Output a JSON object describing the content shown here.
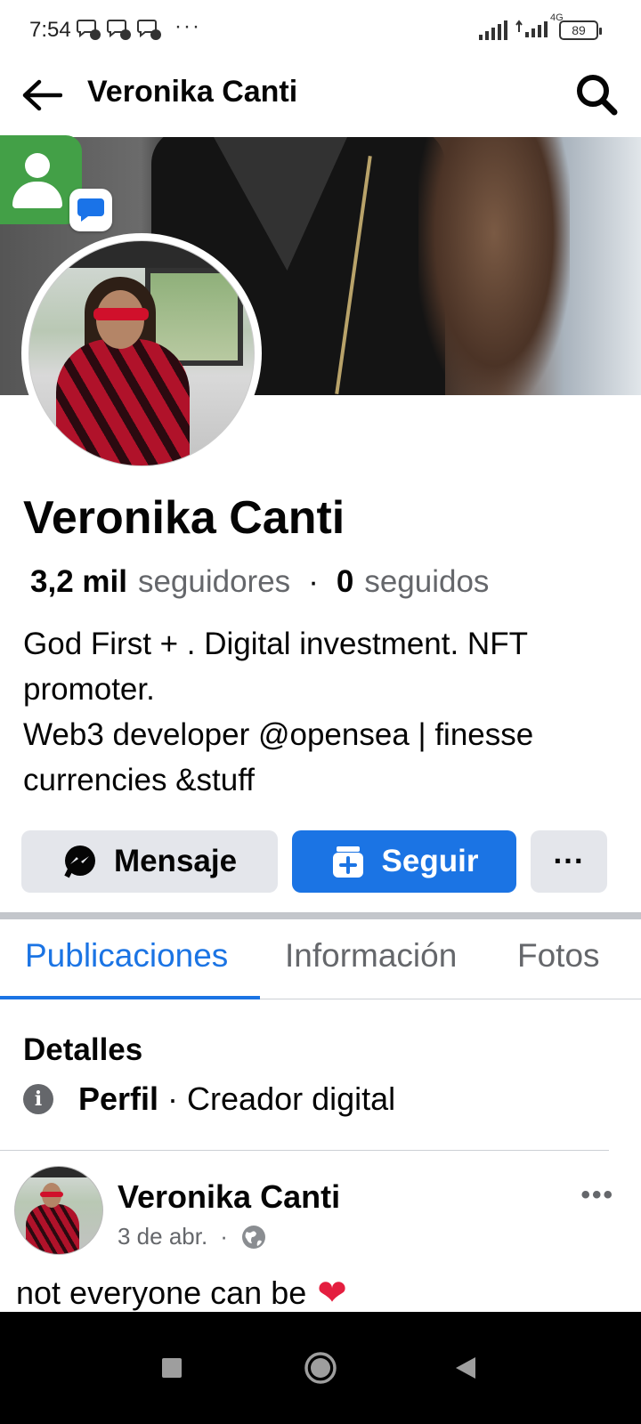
{
  "status_bar": {
    "time": "7:54",
    "more": "···",
    "network": "4G",
    "battery": "89"
  },
  "header": {
    "title": "Veronika Canti"
  },
  "profile": {
    "name": "Veronika Canti",
    "followers_count": "3,2 mil",
    "followers_label": "seguidores",
    "separator": "·",
    "following_count": "0",
    "following_label": "seguidos",
    "bio_lines": [
      "God First + . Digital investment. NFT",
      "promoter.",
      "Web3 developer @opensea | finesse",
      "currencies &stuff"
    ]
  },
  "actions": {
    "message_label": "Mensaje",
    "follow_label": "Seguir",
    "more_label": "···"
  },
  "tabs": [
    {
      "label": "Publicaciones",
      "active": true
    },
    {
      "label": "Información",
      "active": false
    },
    {
      "label": "Fotos",
      "active": false
    }
  ],
  "details": {
    "title": "Detalles",
    "info_icon": "i",
    "profile_label": "Perfil",
    "profile_value": "· Creador digital"
  },
  "post": {
    "author": "Veronika Canti",
    "date": "3 de abr.",
    "dot": "·",
    "more": "•••",
    "text": "not everyone can be",
    "emoji": "❤"
  },
  "colors": {
    "accent": "#1b74e4",
    "secondary_text": "#65676b",
    "button_gray": "#e4e6eb"
  },
  "icons": {
    "back": "arrow-left-icon",
    "search": "search-icon",
    "messenger": "messenger-icon",
    "follow": "follow-icon",
    "info": "info-icon",
    "globe": "globe-icon"
  }
}
